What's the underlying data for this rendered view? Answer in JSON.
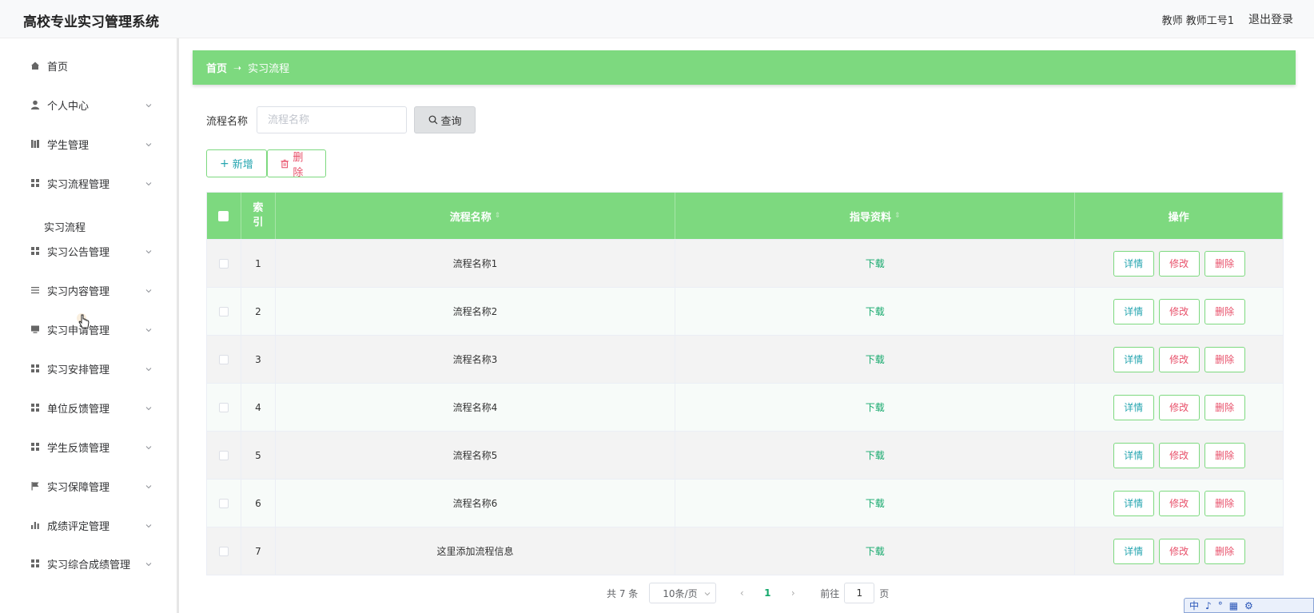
{
  "header": {
    "app_title": "高校专业实习管理系统",
    "user_info": "教师 教师工号1",
    "logout": "退出登录"
  },
  "sidebar": {
    "items": [
      {
        "label": "首页",
        "icon": "home-icon"
      },
      {
        "label": "个人中心",
        "icon": "user-icon"
      },
      {
        "label": "学生管理",
        "icon": "library-icon"
      },
      {
        "label": "实习流程管理",
        "icon": "grid-icon"
      },
      {
        "label": "实习公告管理",
        "icon": "grid-icon"
      },
      {
        "label": "实习内容管理",
        "icon": "list-icon"
      },
      {
        "label": "实习申请管理",
        "icon": "monitor-icon"
      },
      {
        "label": "实习安排管理",
        "icon": "grid-icon"
      },
      {
        "label": "单位反馈管理",
        "icon": "grid-icon"
      },
      {
        "label": "学生反馈管理",
        "icon": "grid-icon"
      },
      {
        "label": "实习保障管理",
        "icon": "flag-icon"
      },
      {
        "label": "成绩评定管理",
        "icon": "bar-chart-icon"
      },
      {
        "label": "实习综合成绩管理",
        "icon": "grid-icon"
      }
    ],
    "submenu": {
      "label": "实习流程"
    }
  },
  "breadcrumb": {
    "home": "首页",
    "current": "实习流程"
  },
  "search": {
    "label": "流程名称",
    "placeholder": "流程名称",
    "button": "查询"
  },
  "actions": {
    "add": "新增",
    "delete": "删除"
  },
  "table": {
    "headers": {
      "index": "索引",
      "name": "流程名称",
      "doc": "指导资料",
      "ops": "操作"
    },
    "row_buttons": {
      "detail": "详情",
      "edit": "修改",
      "remove": "删除"
    },
    "rows": [
      {
        "index": "1",
        "name": "流程名称1",
        "doc": "下载"
      },
      {
        "index": "2",
        "name": "流程名称2",
        "doc": "下载"
      },
      {
        "index": "3",
        "name": "流程名称3",
        "doc": "下载"
      },
      {
        "index": "4",
        "name": "流程名称4",
        "doc": "下载"
      },
      {
        "index": "5",
        "name": "流程名称5",
        "doc": "下载"
      },
      {
        "index": "6",
        "name": "流程名称6",
        "doc": "下载"
      },
      {
        "index": "7",
        "name": "这里添加流程信息",
        "doc": "下载"
      }
    ]
  },
  "pagination": {
    "total": "共 7 条",
    "page_size": "10条/页",
    "current_page": "1",
    "goto_label": "前往",
    "goto_value": "1",
    "page_suffix": "页"
  },
  "ime": {
    "items": [
      "中",
      "♪",
      "°",
      "▦",
      "⚙"
    ]
  },
  "colors": {
    "accent": "#7dd97f",
    "link": "#13a86b",
    "danger": "#e8506a",
    "info": "#26a5b0"
  }
}
